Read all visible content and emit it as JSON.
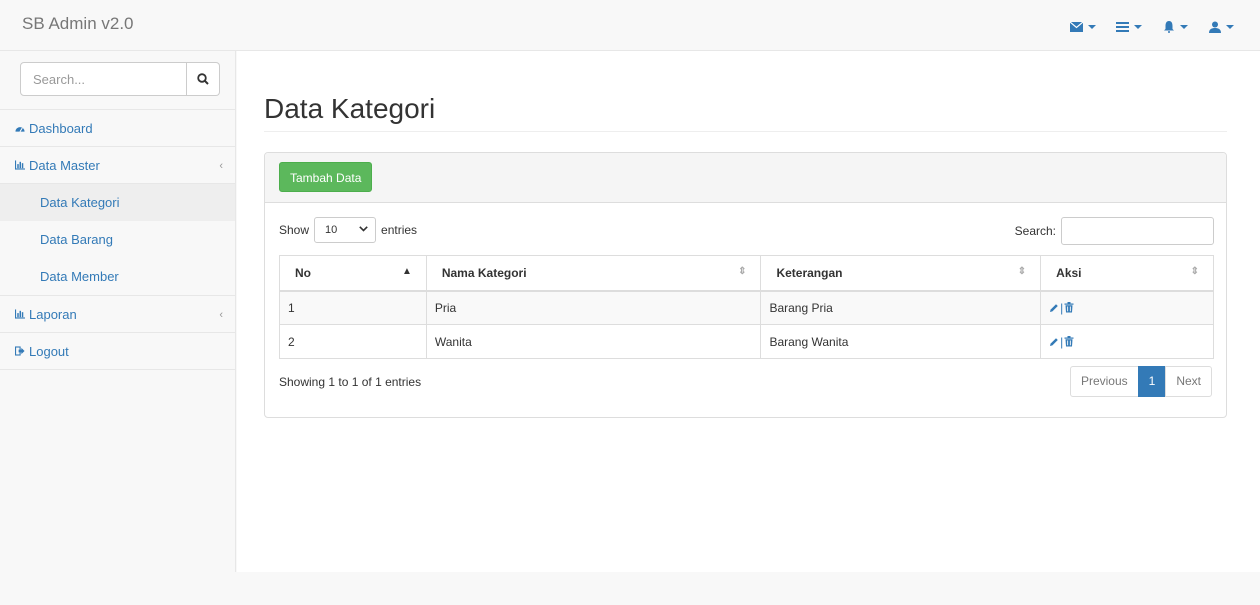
{
  "navbar": {
    "brand": "SB Admin v2.0",
    "icons": [
      "envelope-icon",
      "tasks-icon",
      "bell-icon",
      "user-icon"
    ]
  },
  "sidebar": {
    "search_placeholder": "Search...",
    "items": {
      "dashboard": "Dashboard",
      "data_master": "Data Master",
      "data_kategori": "Data Kategori",
      "data_barang": "Data Barang",
      "data_member": "Data Member",
      "laporan": "Laporan",
      "logout": "Logout"
    }
  },
  "main": {
    "title": "Data Kategori",
    "add_button": "Tambah Data",
    "length": {
      "show": "Show",
      "value": "10",
      "entries": "entries"
    },
    "search_label": "Search:",
    "table": {
      "headers": [
        "No",
        "Nama Kategori",
        "Keterangan",
        "Aksi"
      ],
      "rows": [
        {
          "no": "1",
          "nama": "Pria",
          "keterangan": "Barang Pria"
        },
        {
          "no": "2",
          "nama": "Wanita",
          "keterangan": "Barang Wanita"
        }
      ]
    },
    "info": "Showing 1 to 1 of 1 entries",
    "pagination": {
      "previous": "Previous",
      "page": "1",
      "next": "Next"
    }
  },
  "colors": {
    "link": "#337ab7",
    "add_button": "#5cb85c",
    "active_page": "#337ab7"
  }
}
